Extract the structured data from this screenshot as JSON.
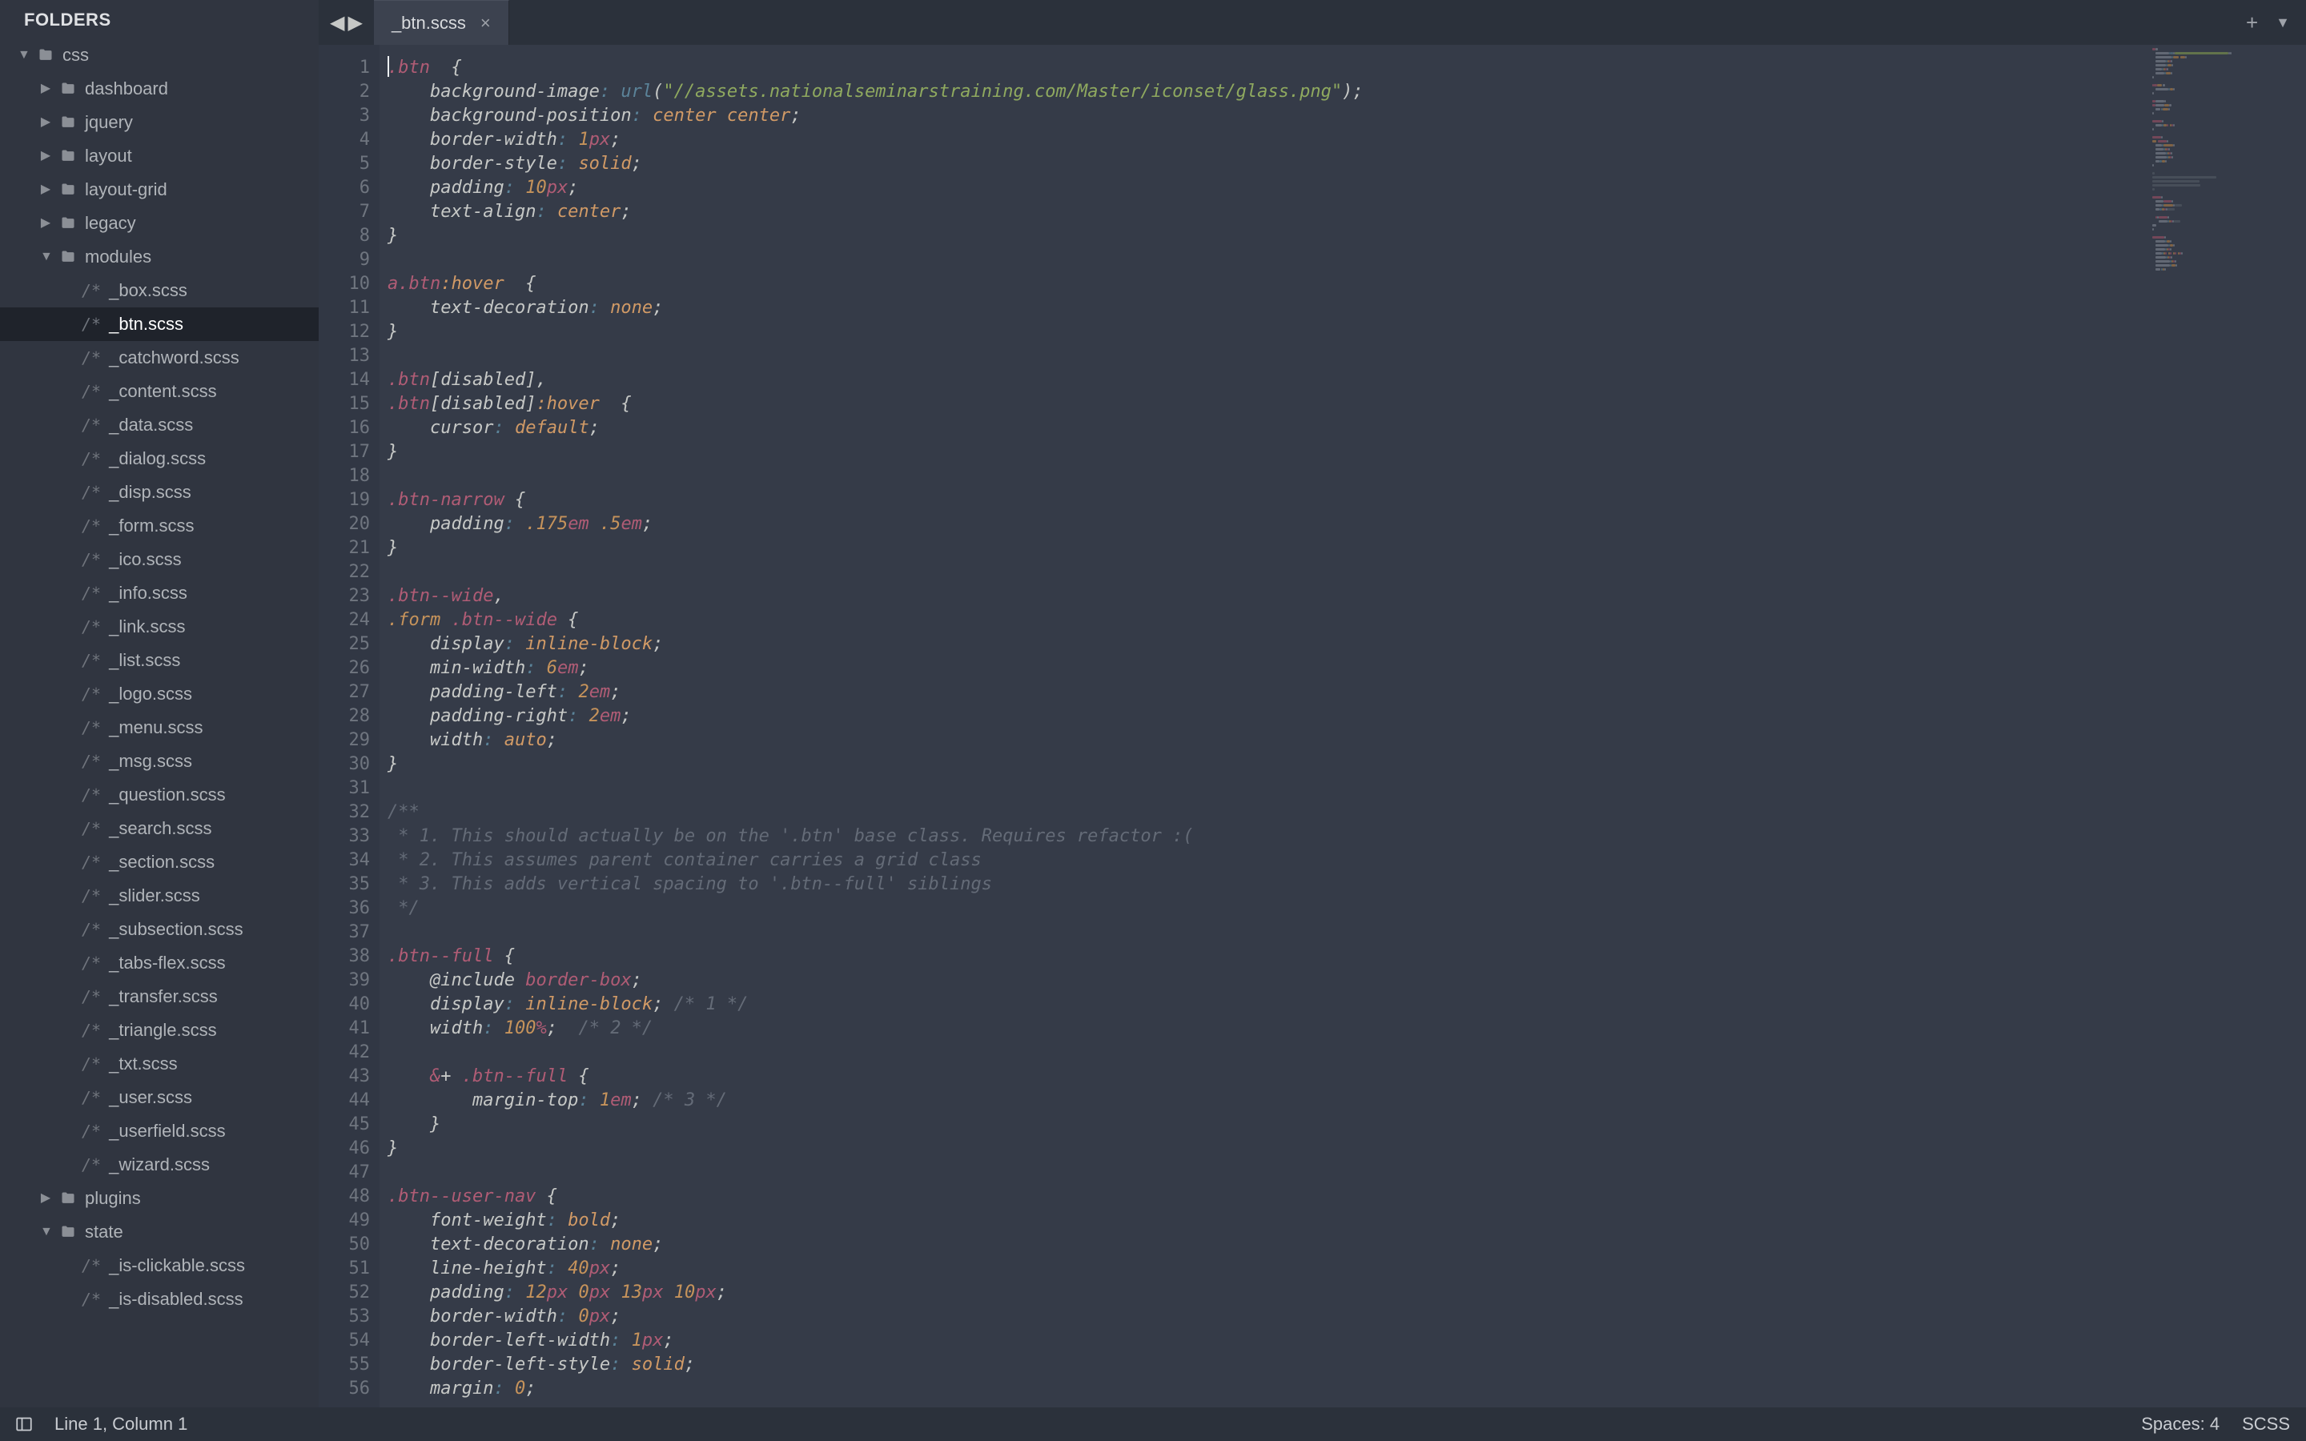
{
  "sidebar": {
    "title": "FOLDERS",
    "tree": [
      {
        "depth": 0,
        "kind": "folder",
        "open": true,
        "name": "css"
      },
      {
        "depth": 1,
        "kind": "folder",
        "open": false,
        "name": "dashboard"
      },
      {
        "depth": 1,
        "kind": "folder",
        "open": false,
        "name": "jquery"
      },
      {
        "depth": 1,
        "kind": "folder",
        "open": false,
        "name": "layout"
      },
      {
        "depth": 1,
        "kind": "folder",
        "open": false,
        "name": "layout-grid"
      },
      {
        "depth": 1,
        "kind": "folder",
        "open": false,
        "name": "legacy"
      },
      {
        "depth": 1,
        "kind": "folder",
        "open": true,
        "name": "modules"
      },
      {
        "depth": 2,
        "kind": "file",
        "name": "_box.scss"
      },
      {
        "depth": 2,
        "kind": "file",
        "name": "_btn.scss",
        "selected": true
      },
      {
        "depth": 2,
        "kind": "file",
        "name": "_catchword.scss"
      },
      {
        "depth": 2,
        "kind": "file",
        "name": "_content.scss"
      },
      {
        "depth": 2,
        "kind": "file",
        "name": "_data.scss"
      },
      {
        "depth": 2,
        "kind": "file",
        "name": "_dialog.scss"
      },
      {
        "depth": 2,
        "kind": "file",
        "name": "_disp.scss"
      },
      {
        "depth": 2,
        "kind": "file",
        "name": "_form.scss"
      },
      {
        "depth": 2,
        "kind": "file",
        "name": "_ico.scss"
      },
      {
        "depth": 2,
        "kind": "file",
        "name": "_info.scss"
      },
      {
        "depth": 2,
        "kind": "file",
        "name": "_link.scss"
      },
      {
        "depth": 2,
        "kind": "file",
        "name": "_list.scss"
      },
      {
        "depth": 2,
        "kind": "file",
        "name": "_logo.scss"
      },
      {
        "depth": 2,
        "kind": "file",
        "name": "_menu.scss"
      },
      {
        "depth": 2,
        "kind": "file",
        "name": "_msg.scss"
      },
      {
        "depth": 2,
        "kind": "file",
        "name": "_question.scss"
      },
      {
        "depth": 2,
        "kind": "file",
        "name": "_search.scss"
      },
      {
        "depth": 2,
        "kind": "file",
        "name": "_section.scss"
      },
      {
        "depth": 2,
        "kind": "file",
        "name": "_slider.scss"
      },
      {
        "depth": 2,
        "kind": "file",
        "name": "_subsection.scss"
      },
      {
        "depth": 2,
        "kind": "file",
        "name": "_tabs-flex.scss"
      },
      {
        "depth": 2,
        "kind": "file",
        "name": "_transfer.scss"
      },
      {
        "depth": 2,
        "kind": "file",
        "name": "_triangle.scss"
      },
      {
        "depth": 2,
        "kind": "file",
        "name": "_txt.scss"
      },
      {
        "depth": 2,
        "kind": "file",
        "name": "_user.scss"
      },
      {
        "depth": 2,
        "kind": "file",
        "name": "_userfield.scss"
      },
      {
        "depth": 2,
        "kind": "file",
        "name": "_wizard.scss"
      },
      {
        "depth": 1,
        "kind": "folder",
        "open": false,
        "name": "plugins"
      },
      {
        "depth": 1,
        "kind": "folder",
        "open": true,
        "name": "state"
      },
      {
        "depth": 2,
        "kind": "file",
        "name": "_is-clickable.scss"
      },
      {
        "depth": 2,
        "kind": "file",
        "name": "_is-disabled.scss"
      }
    ]
  },
  "tabs": {
    "history_back": "◀",
    "history_fwd": "▶",
    "open": [
      {
        "title": "_btn.scss",
        "dirty": false
      }
    ],
    "add": "+",
    "menu": "▼"
  },
  "editor": {
    "line_count": 56,
    "code": [
      [
        [
          "sel",
          ".btn"
        ],
        [
          "punc",
          "  {"
        ]
      ],
      [
        [
          "punc",
          "    "
        ],
        [
          "prop",
          "background-image"
        ],
        [
          "sep",
          ": "
        ],
        [
          "sep",
          "url"
        ],
        [
          "punc",
          "("
        ],
        [
          "str",
          "\"//assets.nationalseminarstraining.com/Master/iconset/glass.png\""
        ],
        [
          "punc",
          ")"
        ],
        [
          "punc",
          ";"
        ]
      ],
      [
        [
          "punc",
          "    "
        ],
        [
          "prop",
          "background-position"
        ],
        [
          "sep",
          ": "
        ],
        [
          "val",
          "center"
        ],
        [
          "punc",
          " "
        ],
        [
          "val",
          "center"
        ],
        [
          "punc",
          ";"
        ]
      ],
      [
        [
          "punc",
          "    "
        ],
        [
          "prop",
          "border-width"
        ],
        [
          "sep",
          ": "
        ],
        [
          "num",
          "1"
        ],
        [
          "unit",
          "px"
        ],
        [
          "punc",
          ";"
        ]
      ],
      [
        [
          "punc",
          "    "
        ],
        [
          "prop",
          "border-style"
        ],
        [
          "sep",
          ": "
        ],
        [
          "val",
          "solid"
        ],
        [
          "punc",
          ";"
        ]
      ],
      [
        [
          "punc",
          "    "
        ],
        [
          "prop",
          "padding"
        ],
        [
          "sep",
          ": "
        ],
        [
          "num",
          "10"
        ],
        [
          "unit",
          "px"
        ],
        [
          "punc",
          ";"
        ]
      ],
      [
        [
          "punc",
          "    "
        ],
        [
          "prop",
          "text-align"
        ],
        [
          "sep",
          ": "
        ],
        [
          "val",
          "center"
        ],
        [
          "punc",
          ";"
        ]
      ],
      [
        [
          "punc",
          "}"
        ]
      ],
      [
        [
          "punc",
          ""
        ]
      ],
      [
        [
          "sel",
          "a"
        ],
        [
          "sel",
          ".btn"
        ],
        [
          "psel",
          ":hover"
        ],
        [
          "punc",
          "  {"
        ]
      ],
      [
        [
          "punc",
          "    "
        ],
        [
          "prop",
          "text-decoration"
        ],
        [
          "sep",
          ": "
        ],
        [
          "val",
          "none"
        ],
        [
          "punc",
          ";"
        ]
      ],
      [
        [
          "punc",
          "}"
        ]
      ],
      [
        [
          "punc",
          ""
        ]
      ],
      [
        [
          "sel",
          ".btn"
        ],
        [
          "attr",
          "[disabled]"
        ],
        [
          "punc",
          ","
        ]
      ],
      [
        [
          "sel",
          ".btn"
        ],
        [
          "attr",
          "[disabled]"
        ],
        [
          "psel",
          ":hover"
        ],
        [
          "punc",
          "  {"
        ]
      ],
      [
        [
          "punc",
          "    "
        ],
        [
          "prop",
          "cursor"
        ],
        [
          "sep",
          ": "
        ],
        [
          "val",
          "default"
        ],
        [
          "punc",
          ";"
        ]
      ],
      [
        [
          "punc",
          "}"
        ]
      ],
      [
        [
          "punc",
          ""
        ]
      ],
      [
        [
          "sel",
          ".btn-narrow"
        ],
        [
          "punc",
          " {"
        ]
      ],
      [
        [
          "punc",
          "    "
        ],
        [
          "prop",
          "padding"
        ],
        [
          "sep",
          ": "
        ],
        [
          "num",
          ".175"
        ],
        [
          "unit",
          "em"
        ],
        [
          "punc",
          " "
        ],
        [
          "num",
          ".5"
        ],
        [
          "unit",
          "em"
        ],
        [
          "punc",
          ";"
        ]
      ],
      [
        [
          "punc",
          "}"
        ]
      ],
      [
        [
          "punc",
          ""
        ]
      ],
      [
        [
          "sel",
          ".btn--wide"
        ],
        [
          "punc",
          ","
        ]
      ],
      [
        [
          "cls",
          ".form"
        ],
        [
          "punc",
          " "
        ],
        [
          "sel",
          ".btn--wide"
        ],
        [
          "punc",
          " {"
        ]
      ],
      [
        [
          "punc",
          "    "
        ],
        [
          "prop",
          "display"
        ],
        [
          "sep",
          ": "
        ],
        [
          "val",
          "inline-block"
        ],
        [
          "punc",
          ";"
        ]
      ],
      [
        [
          "punc",
          "    "
        ],
        [
          "prop",
          "min-width"
        ],
        [
          "sep",
          ": "
        ],
        [
          "num",
          "6"
        ],
        [
          "unit",
          "em"
        ],
        [
          "punc",
          ";"
        ]
      ],
      [
        [
          "punc",
          "    "
        ],
        [
          "prop",
          "padding-left"
        ],
        [
          "sep",
          ": "
        ],
        [
          "num",
          "2"
        ],
        [
          "unit",
          "em"
        ],
        [
          "punc",
          ";"
        ]
      ],
      [
        [
          "punc",
          "    "
        ],
        [
          "prop",
          "padding-right"
        ],
        [
          "sep",
          ": "
        ],
        [
          "num",
          "2"
        ],
        [
          "unit",
          "em"
        ],
        [
          "punc",
          ";"
        ]
      ],
      [
        [
          "punc",
          "    "
        ],
        [
          "prop",
          "width"
        ],
        [
          "sep",
          ": "
        ],
        [
          "val",
          "auto"
        ],
        [
          "punc",
          ";"
        ]
      ],
      [
        [
          "punc",
          "}"
        ]
      ],
      [
        [
          "punc",
          ""
        ]
      ],
      [
        [
          "cmt",
          "/**"
        ]
      ],
      [
        [
          "cmt",
          " * 1. This should actually be on the '.btn' base class. Requires refactor :("
        ]
      ],
      [
        [
          "cmt",
          " * 2. This assumes parent container carries a grid class"
        ]
      ],
      [
        [
          "cmt",
          " * 3. This adds vertical spacing to '.btn--full' siblings"
        ]
      ],
      [
        [
          "cmt",
          " */"
        ]
      ],
      [
        [
          "punc",
          ""
        ]
      ],
      [
        [
          "sel",
          ".btn--full"
        ],
        [
          "punc",
          " {"
        ]
      ],
      [
        [
          "punc",
          "    "
        ],
        [
          "atinc",
          "@include "
        ],
        [
          "sel",
          "border-box"
        ],
        [
          "punc",
          ";"
        ]
      ],
      [
        [
          "punc",
          "    "
        ],
        [
          "prop",
          "display"
        ],
        [
          "sep",
          ": "
        ],
        [
          "val",
          "inline-block"
        ],
        [
          "punc",
          ";"
        ],
        [
          "cmt",
          " /* 1 */"
        ]
      ],
      [
        [
          "punc",
          "    "
        ],
        [
          "prop",
          "width"
        ],
        [
          "sep",
          ": "
        ],
        [
          "num",
          "100"
        ],
        [
          "unit",
          "%"
        ],
        [
          "punc",
          ";"
        ],
        [
          "cmt",
          "  /* 2 */"
        ]
      ],
      [
        [
          "punc",
          ""
        ]
      ],
      [
        [
          "punc",
          "    "
        ],
        [
          "amp",
          "&"
        ],
        [
          "punc",
          "+ "
        ],
        [
          "sel",
          ".btn--full"
        ],
        [
          "punc",
          " {"
        ]
      ],
      [
        [
          "punc",
          "        "
        ],
        [
          "prop",
          "margin-top"
        ],
        [
          "sep",
          ": "
        ],
        [
          "num",
          "1"
        ],
        [
          "unit",
          "em"
        ],
        [
          "punc",
          ";"
        ],
        [
          "cmt",
          " /* 3 */"
        ]
      ],
      [
        [
          "punc",
          "    }"
        ]
      ],
      [
        [
          "punc",
          "}"
        ]
      ],
      [
        [
          "punc",
          ""
        ]
      ],
      [
        [
          "sel",
          ".btn--user-nav"
        ],
        [
          "punc",
          " {"
        ]
      ],
      [
        [
          "punc",
          "    "
        ],
        [
          "prop",
          "font-weight"
        ],
        [
          "sep",
          ": "
        ],
        [
          "val",
          "bold"
        ],
        [
          "punc",
          ";"
        ]
      ],
      [
        [
          "punc",
          "    "
        ],
        [
          "prop",
          "text-decoration"
        ],
        [
          "sep",
          ": "
        ],
        [
          "val",
          "none"
        ],
        [
          "punc",
          ";"
        ]
      ],
      [
        [
          "punc",
          "    "
        ],
        [
          "prop",
          "line-height"
        ],
        [
          "sep",
          ": "
        ],
        [
          "num",
          "40"
        ],
        [
          "unit",
          "px"
        ],
        [
          "punc",
          ";"
        ]
      ],
      [
        [
          "punc",
          "    "
        ],
        [
          "prop",
          "padding"
        ],
        [
          "sep",
          ": "
        ],
        [
          "num",
          "12"
        ],
        [
          "unit",
          "px"
        ],
        [
          "punc",
          " "
        ],
        [
          "num",
          "0"
        ],
        [
          "unit",
          "px"
        ],
        [
          "punc",
          " "
        ],
        [
          "num",
          "13"
        ],
        [
          "unit",
          "px"
        ],
        [
          "punc",
          " "
        ],
        [
          "num",
          "10"
        ],
        [
          "unit",
          "px"
        ],
        [
          "punc",
          ";"
        ]
      ],
      [
        [
          "punc",
          "    "
        ],
        [
          "prop",
          "border-width"
        ],
        [
          "sep",
          ": "
        ],
        [
          "num",
          "0"
        ],
        [
          "unit",
          "px"
        ],
        [
          "punc",
          ";"
        ]
      ],
      [
        [
          "punc",
          "    "
        ],
        [
          "prop",
          "border-left-width"
        ],
        [
          "sep",
          ": "
        ],
        [
          "num",
          "1"
        ],
        [
          "unit",
          "px"
        ],
        [
          "punc",
          ";"
        ]
      ],
      [
        [
          "punc",
          "    "
        ],
        [
          "prop",
          "border-left-style"
        ],
        [
          "sep",
          ": "
        ],
        [
          "val",
          "solid"
        ],
        [
          "punc",
          ";"
        ]
      ],
      [
        [
          "punc",
          "    "
        ],
        [
          "prop",
          "margin"
        ],
        [
          "sep",
          ": "
        ],
        [
          "num",
          "0"
        ],
        [
          "punc",
          ";"
        ]
      ]
    ]
  },
  "status": {
    "position": "Line 1, Column 1",
    "indent": "Spaces: 4",
    "syntax": "SCSS"
  },
  "colors": {
    "bg": "#353b48",
    "sidebar": "#303540",
    "tabbar": "#2b313b",
    "active_tab": "#3c424f",
    "gutter": "#313744",
    "selection_row": "#1f232b"
  }
}
